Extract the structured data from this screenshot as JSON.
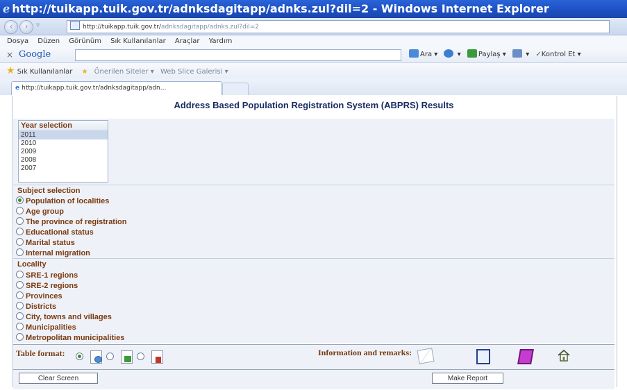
{
  "window": {
    "title": "http://tuikapp.tuik.gov.tr/adnksdagitapp/adnks.zul?dil=2 - Windows Internet Explorer"
  },
  "addressbar": {
    "url_domain": "http://tuikapp.tuik.gov.tr/",
    "url_path": "adnksdagitapp/adnks.zul?dil=2"
  },
  "menu": [
    "Dosya",
    "Düzen",
    "Görünüm",
    "Sık Kullanılanlar",
    "Araçlar",
    "Yardım"
  ],
  "googlebar": {
    "close": "×",
    "logo": "Google",
    "search_label": "Ara",
    "share_label": "Paylaş",
    "check_label": "Kontrol Et"
  },
  "favorites": {
    "label": "Sık Kullanılanlar",
    "suggested": "Önerilen Siteler",
    "webslice": "Web Slice Galerisi"
  },
  "tab": {
    "title": "http://tuikapp.tuik.gov.tr/adnksdagitapp/adn..."
  },
  "page": {
    "title": "Address Based Population Registration System (ABPRS) Results",
    "year": {
      "header": "Year selection",
      "options": [
        "2011",
        "2010",
        "2009",
        "2008",
        "2007"
      ],
      "selected": "2011"
    },
    "subject": {
      "label": "Subject selection",
      "options": [
        "Population of localities",
        "Age group",
        "The province of registration",
        "Educational status",
        "Marital status",
        "Internal migration"
      ],
      "selected_index": 0
    },
    "locality": {
      "label": "Locality",
      "options": [
        "SRE-1 regions",
        "SRE-2 regions",
        "Provinces",
        "Districts",
        "City, towns and villages",
        "Municipalities",
        "Metropolitan municipalities"
      ]
    },
    "format": {
      "label": "Table format:",
      "info_label": "Information and remarks:"
    },
    "buttons": {
      "clear": "Clear Screen",
      "report": "Make Report"
    }
  }
}
